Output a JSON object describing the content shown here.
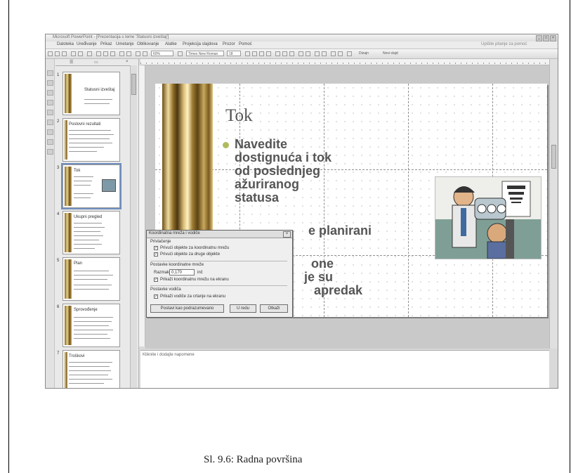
{
  "window": {
    "title": "Microsoft PowerPoint - [Prezentacija s teme 'Statusni izveštaj']"
  },
  "menubar": {
    "items": [
      "Datoteka",
      "Uređivanje",
      "Prikaz",
      "Umetanje",
      "Oblikovanje",
      "Alatke",
      "Projekcija slajdova",
      "Prozor",
      "Pomoć"
    ],
    "help_placeholder": "Upišite pitanje za pomoć"
  },
  "toolbar": {
    "zoom": "60%",
    "font": "Times New Roman",
    "font_size": "18",
    "design_label": "Dizajn",
    "new_slide_label": "Novi slajd"
  },
  "slides_panel": {
    "thumbnails": [
      {
        "number": "1",
        "title": "Statusni izveštaj"
      },
      {
        "number": "2",
        "title": "Poslovni rezultati"
      },
      {
        "number": "3",
        "title": "Tok"
      },
      {
        "number": "4",
        "title": "Ukupni pregled"
      },
      {
        "number": "5",
        "title": "Plan"
      },
      {
        "number": "6",
        "title": "Sprovođenje"
      },
      {
        "number": "7",
        "title": "Troškovi"
      }
    ]
  },
  "slide": {
    "title": "Tok",
    "bullet_lines": [
      "Navedite",
      "dostignuća i tok",
      "od poslednjeg",
      "ažuriranog",
      "statusa"
    ],
    "partial_line_1": "e planirani",
    "partial_line_2": "one",
    "partial_line_3": "je su",
    "partial_line_4": "apredak"
  },
  "notes": {
    "placeholder": "Kliknite i dodajte napomene"
  },
  "dialog": {
    "title": "Koordinatna mreža i vodiče",
    "snap_heading": "Privlačenje",
    "snap_grid": "Privući objekte za koordinatnu mrežu",
    "snap_objects": "Privući objekte za druge objekte",
    "grid_heading": "Postavke koordinatne mreže",
    "spacing_label": "Razmak:",
    "spacing_value": "0,170",
    "spacing_unit": "inč",
    "show_grid": "Prikaži koordinatnu mrežu na ekranu",
    "guides_heading": "Postavke vodiča",
    "show_guides": "Prikaži vodiče za crtanje na ekranu",
    "default_button": "Postavi kao podrazumevano",
    "ok_button": "U redu",
    "cancel_button": "Otkaži"
  },
  "caption": "Sl. 9.6: Radna površina"
}
